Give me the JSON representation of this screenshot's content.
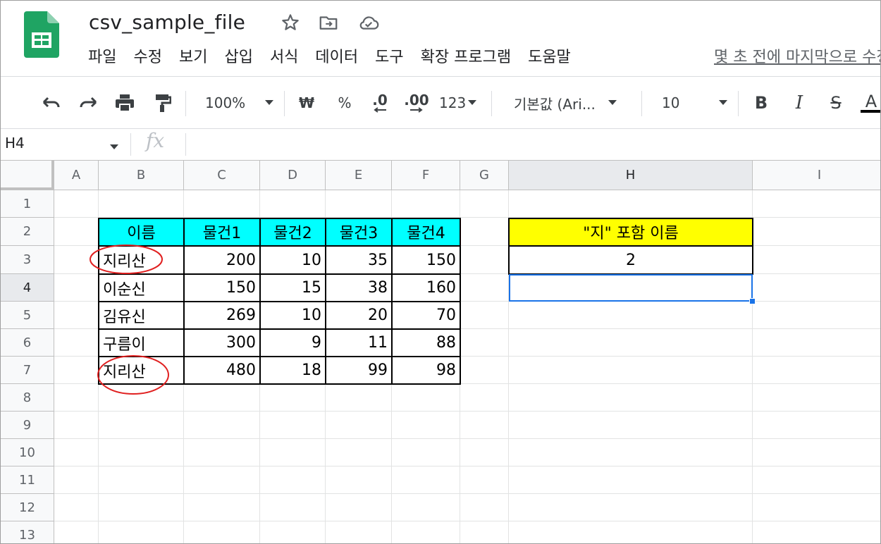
{
  "app": {
    "doc_title": "csv_sample_file",
    "logo_icon": "google-sheets-icon",
    "accent_green": "#1fa463"
  },
  "menu": [
    "파일",
    "수정",
    "보기",
    "삽입",
    "서식",
    "데이터",
    "도구",
    "확장 프로그램",
    "도움말"
  ],
  "last_edit": "몇 초 전에 마지막으로 수정했습니다",
  "toolbar": {
    "zoom": "100%",
    "currency": "₩",
    "percent": "%",
    "decrease_decimal": ".0",
    "increase_decimal": ".00",
    "number_format": "123",
    "font": "기본값 (Ari...",
    "font_size": "10",
    "bold": "B",
    "italic": "I",
    "strike": "S",
    "text_color": "A"
  },
  "formula_bar": {
    "name_box": "H4",
    "fx": "fx",
    "value": ""
  },
  "columns": [
    "A",
    "B",
    "C",
    "D",
    "E",
    "F",
    "G",
    "H",
    "I"
  ],
  "selected_column": "H",
  "rows": [
    "1",
    "2",
    "3",
    "4",
    "5",
    "6",
    "7",
    "8",
    "9",
    "10",
    "11",
    "12",
    "13"
  ],
  "selected_row": "4",
  "table": {
    "header_fill": "#00ffff",
    "headers": [
      "이름",
      "물건1",
      "물건2",
      "물건3",
      "물건4"
    ],
    "rows": [
      [
        "지리산",
        "200",
        "10",
        "35",
        "150"
      ],
      [
        "이순신",
        "150",
        "15",
        "38",
        "160"
      ],
      [
        "김유신",
        "269",
        "10",
        "20",
        "70"
      ],
      [
        "구름이",
        "300",
        "9",
        "11",
        "88"
      ],
      [
        "지리산",
        "480",
        "18",
        "99",
        "98"
      ]
    ]
  },
  "result": {
    "header_fill": "#ffff00",
    "header": "\"지\" 포함 이름",
    "value": "2",
    "selected_cell_value": ""
  },
  "annotations": {
    "circle_color": "#e02020"
  }
}
